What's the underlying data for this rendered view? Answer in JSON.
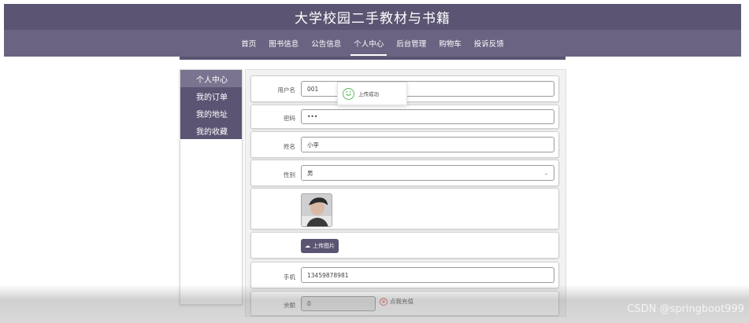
{
  "header": {
    "title": "大学校园二手教材与书籍"
  },
  "nav": {
    "items": [
      {
        "label": "首页"
      },
      {
        "label": "图书信息"
      },
      {
        "label": "公告信息"
      },
      {
        "label": "个人中心"
      },
      {
        "label": "后台管理"
      },
      {
        "label": "购物车"
      },
      {
        "label": "投诉反馈"
      }
    ],
    "active_index": 3
  },
  "sidebar": {
    "items": [
      {
        "label": "个人中心"
      },
      {
        "label": "我的订单"
      },
      {
        "label": "我的地址"
      },
      {
        "label": "我的收藏"
      }
    ]
  },
  "form": {
    "username": {
      "label": "用户名",
      "value": "001"
    },
    "password": {
      "label": "密码",
      "value": "•••"
    },
    "name": {
      "label": "姓名",
      "value": "小李"
    },
    "gender": {
      "label": "性别",
      "value": "男"
    },
    "upload": {
      "label": "上传图片"
    },
    "phone": {
      "label": "手机",
      "value": "13459878981"
    },
    "balance": {
      "label": "余额",
      "value": "0",
      "recharge_label": "点我充值"
    }
  },
  "toast": {
    "message": "上传成功"
  },
  "watermark": {
    "text": "CSDN @springboot999"
  },
  "colors": {
    "primary": "#5b5472",
    "nav": "#6a6381",
    "success": "#5cb85c",
    "recharge": "#e26a6a"
  }
}
